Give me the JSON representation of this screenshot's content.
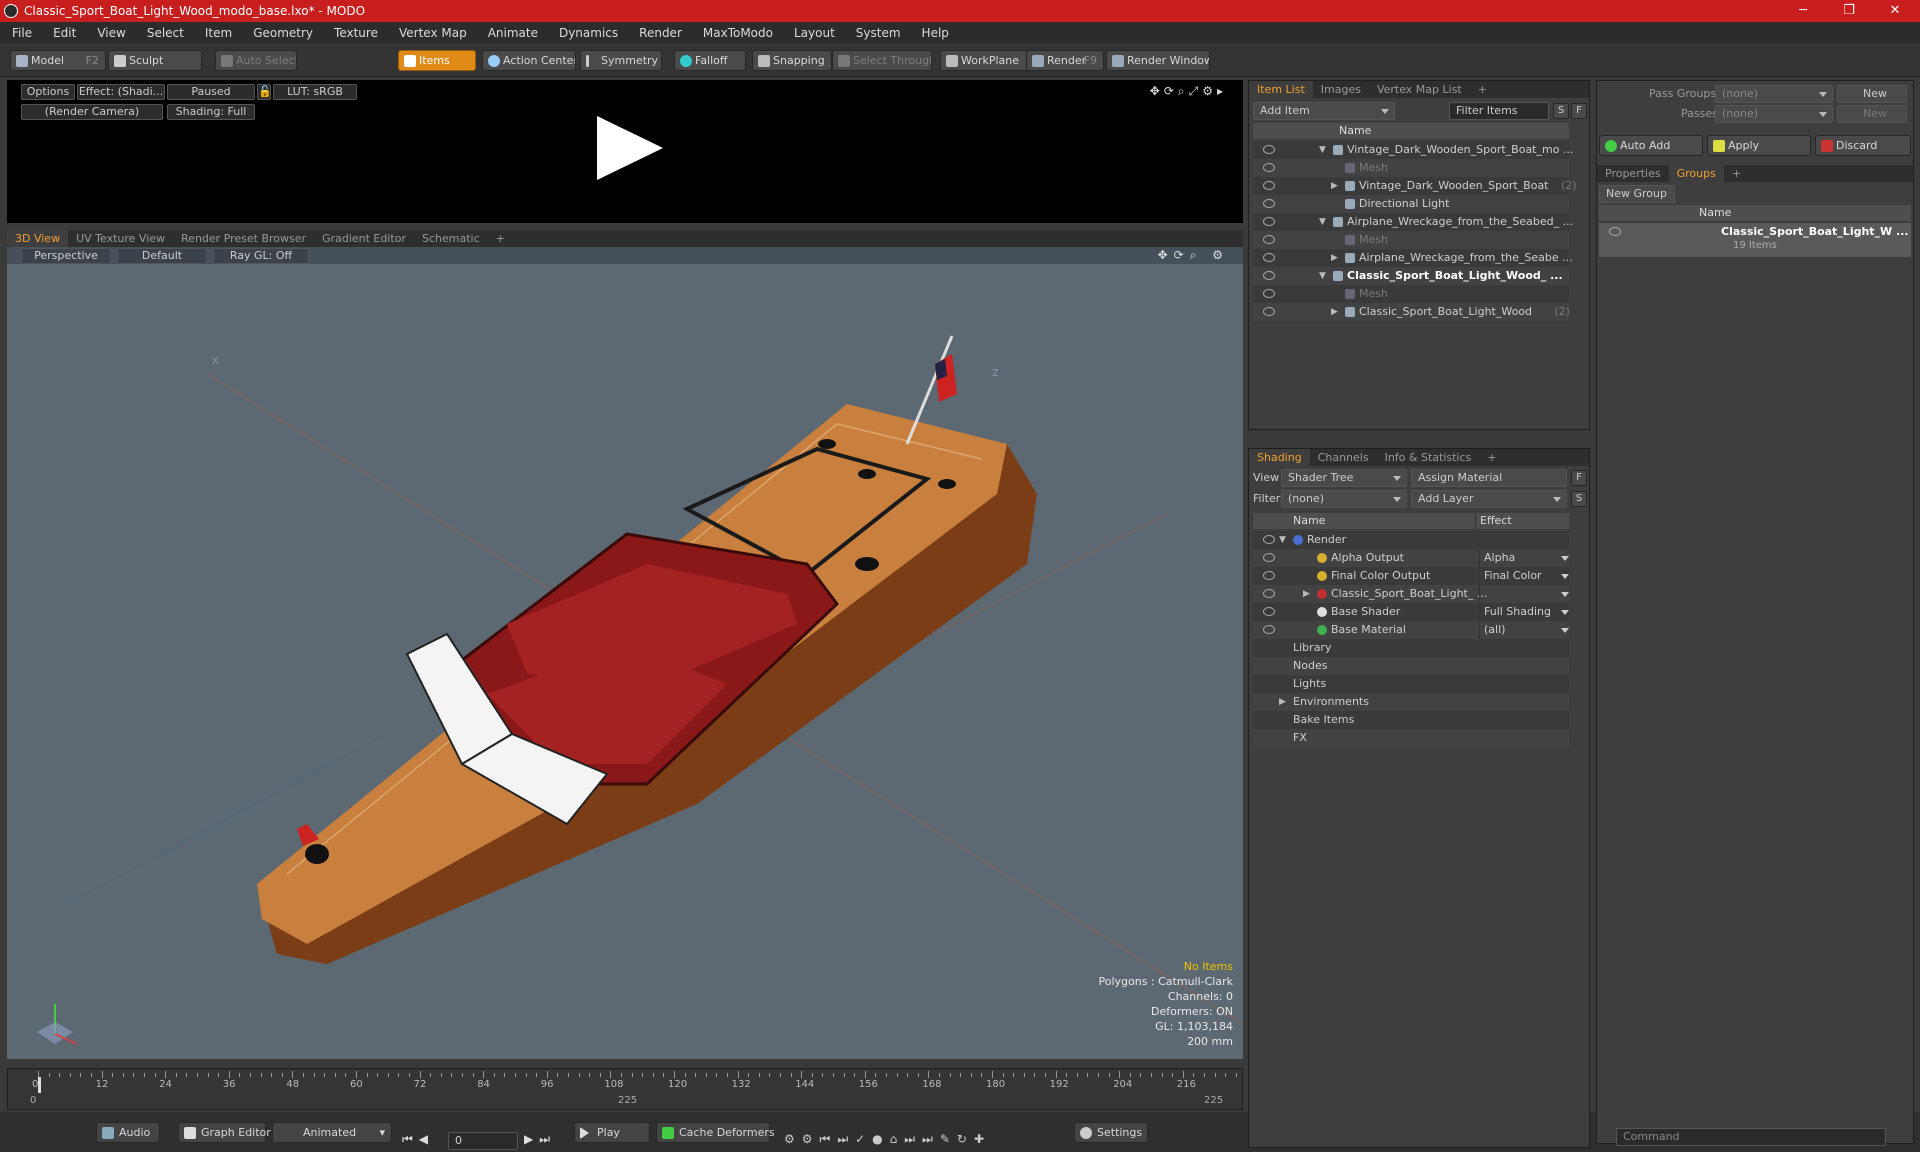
{
  "window": {
    "title": "Classic_Sport_Boat_Light_Wood_modo_base.lxo* - MODO",
    "minimize": "─",
    "maximize": "❐",
    "close": "✕"
  },
  "menu": [
    "File",
    "Edit",
    "View",
    "Select",
    "Item",
    "Geometry",
    "Texture",
    "Vertex Map",
    "Animate",
    "Dynamics",
    "Render",
    "MaxToModo",
    "Layout",
    "System",
    "Help"
  ],
  "toolbar": {
    "model": "Model",
    "model_key": "F2",
    "sculpt": "Sculpt",
    "auto_select": "Auto Select",
    "items": "Items",
    "action_center": "Action Center",
    "symmetry": "Symmetry",
    "falloff": "Falloff",
    "snapping": "Snapping",
    "select_through": "Select Through",
    "workplane": "WorkPlane",
    "render": "Render",
    "render_key": "F9",
    "render_window": "Render Window"
  },
  "preview": {
    "options": "Options",
    "effect": "Effect: (Shadi...",
    "paused": "Paused",
    "lut": "LUT: sRGB",
    "camera": "(Render Camera)",
    "shading": "Shading: Full"
  },
  "view_tabs": [
    "3D View",
    "UV Texture View",
    "Render Preset Browser",
    "Gradient Editor",
    "Schematic",
    "+"
  ],
  "viewport": {
    "perspective": "Perspective",
    "default": "Default",
    "raygl": "Ray GL: Off",
    "axis_x": "X",
    "axis_z": "Z",
    "stats": {
      "no_items": "No Items",
      "polygons": "Polygons : Catmull-Clark",
      "channels": "Channels: 0",
      "deformers": "Deformers: ON",
      "gl": "GL: 1,103,184",
      "scale": "200 mm"
    }
  },
  "timeline": {
    "ticks": [
      "0",
      "12",
      "24",
      "36",
      "48",
      "60",
      "72",
      "84",
      "96",
      "108",
      "120",
      "132",
      "144",
      "156",
      "168",
      "180",
      "192",
      "204",
      "216"
    ],
    "start": "0",
    "mid": "225",
    "end": "225"
  },
  "bottom": {
    "audio": "Audio",
    "graph_editor": "Graph Editor",
    "animated": "Animated",
    "frame": "0",
    "play": "Play",
    "cache": "Cache Deformers",
    "settings": "Settings",
    "command": "Command"
  },
  "item_list": {
    "tabs": [
      "Item List",
      "Images",
      "Vertex Map List",
      "+"
    ],
    "add_item": "Add Item",
    "filter": "Filter Items",
    "s": "S",
    "f": "F",
    "col_name": "Name",
    "rows": [
      {
        "label": "Vintage_Dark_Wooden_Sport_Boat_mo ...",
        "indent": 0,
        "expand": "▼",
        "style": ""
      },
      {
        "label": "Mesh",
        "indent": 1,
        "expand": "",
        "style": "faint"
      },
      {
        "label": "Vintage_Dark_Wooden_Sport_Boat",
        "extra": "(2)",
        "indent": 1,
        "expand": "▶",
        "style": ""
      },
      {
        "label": "Directional Light",
        "indent": 1,
        "expand": "",
        "style": ""
      },
      {
        "label": "Airplane_Wreckage_from_the_Seabed_ ...",
        "indent": 0,
        "expand": "▼",
        "style": ""
      },
      {
        "label": "Mesh",
        "indent": 1,
        "expand": "",
        "style": "faint"
      },
      {
        "label": "Airplane_Wreckage_from_the_Seabe ...",
        "indent": 1,
        "expand": "▶",
        "style": ""
      },
      {
        "label": "Classic_Sport_Boat_Light_Wood_ ...",
        "indent": 0,
        "expand": "▼",
        "style": "bold"
      },
      {
        "label": "Mesh",
        "indent": 1,
        "expand": "",
        "style": "faint"
      },
      {
        "label": "Classic_Sport_Boat_Light_Wood",
        "extra": "(2)",
        "indent": 1,
        "expand": "▶",
        "style": ""
      }
    ]
  },
  "shading": {
    "tabs": [
      "Shading",
      "Channels",
      "Info & Statistics",
      "+"
    ],
    "view_label": "View",
    "view_value": "Shader Tree",
    "assign": "Assign Material",
    "f": "F",
    "filter_label": "Filter",
    "filter_value": "(none)",
    "add_layer": "Add Layer",
    "s": "S",
    "col_name": "Name",
    "col_effect": "Effect",
    "rows": [
      {
        "label": "Render",
        "effect": "",
        "indent": 0,
        "expand": "▼",
        "icon": "#4a6fd1",
        "eye": true
      },
      {
        "label": "Alpha Output",
        "effect": "Alpha",
        "indent": 1,
        "expand": "",
        "icon": "#d8b030",
        "eye": true
      },
      {
        "label": "Final Color Output",
        "effect": "Final Color",
        "indent": 1,
        "expand": "",
        "icon": "#d8b030",
        "eye": true
      },
      {
        "label": "Classic_Sport_Boat_Light_ ...",
        "effect": "",
        "indent": 1,
        "expand": "▶",
        "icon": "#c03030",
        "eye": true
      },
      {
        "label": "Base Shader",
        "effect": "Full Shading",
        "indent": 1,
        "expand": "",
        "icon": "#dddddd",
        "eye": true
      },
      {
        "label": "Base Material",
        "effect": "(all)",
        "indent": 1,
        "expand": "",
        "icon": "#40b050",
        "eye": true
      },
      {
        "label": "Library",
        "effect": "",
        "indent": 0,
        "expand": "",
        "icon": "",
        "eye": false
      },
      {
        "label": "Nodes",
        "effect": "",
        "indent": 0,
        "expand": "",
        "icon": "",
        "eye": false
      },
      {
        "label": "Lights",
        "effect": "",
        "indent": 0,
        "expand": "",
        "icon": "",
        "eye": false
      },
      {
        "label": "Environments",
        "effect": "",
        "indent": 0,
        "expand": "▶",
        "icon": "",
        "eye": false
      },
      {
        "label": "Bake Items",
        "effect": "",
        "indent": 0,
        "expand": "",
        "icon": "",
        "eye": false
      },
      {
        "label": "FX",
        "effect": "",
        "indent": 0,
        "expand": "",
        "icon": "",
        "eye": false
      }
    ]
  },
  "groups": {
    "pass_groups": "Pass Groups",
    "passes": "Passes",
    "none": "(none)",
    "new": "New",
    "auto_add": "Auto Add",
    "apply": "Apply",
    "discard": "Discard",
    "tabs": [
      "Properties",
      "Groups",
      "+"
    ],
    "new_group": "New Group",
    "col_name": "Name",
    "item": "Classic_Sport_Boat_Light_W ...",
    "item_count": "19 Items"
  }
}
